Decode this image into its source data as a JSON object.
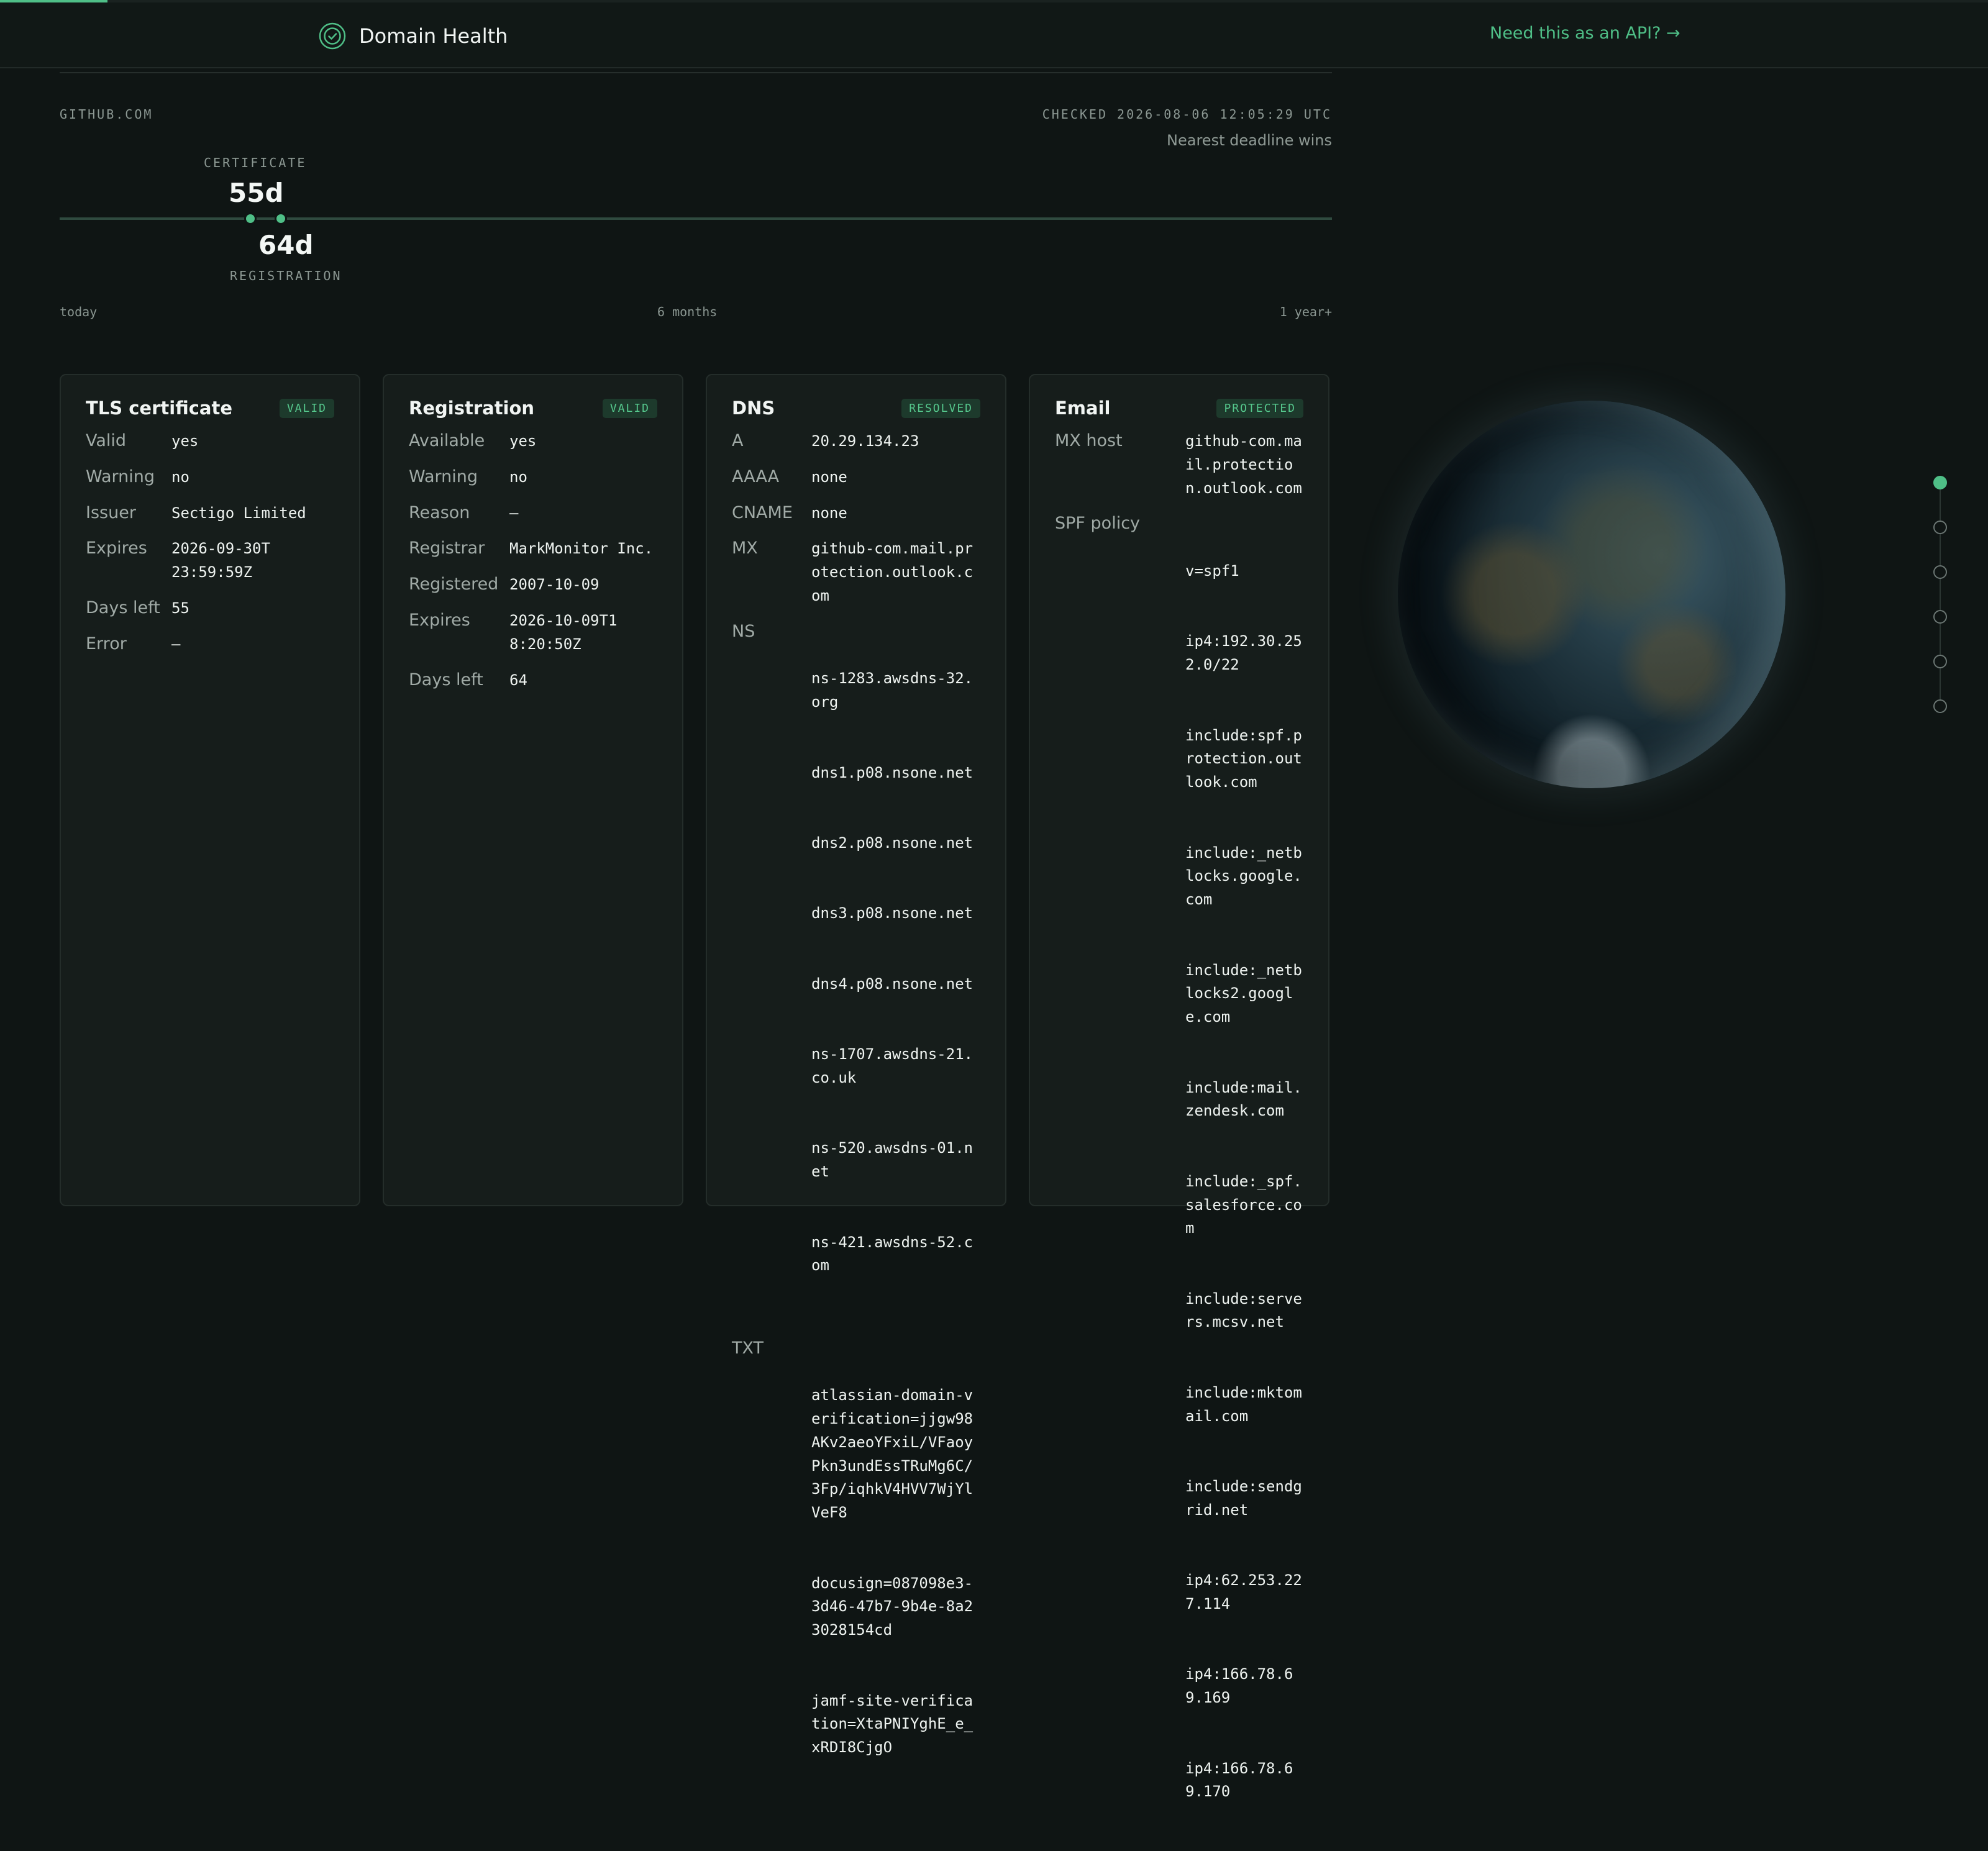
{
  "header": {
    "brand_name": "Domain Health",
    "api_link": "Need this as an API? →",
    "progress": 0.054
  },
  "summary": {
    "domain": "GITHUB.COM",
    "checked": "CHECKED 2026-08-06 12:05:29 UTC",
    "deadline_note": "Nearest deadline wins",
    "certificate_label": "CERTIFICATE",
    "certificate_days": "55d",
    "registration_label": "REGISTRATION",
    "registration_days": "64d",
    "axis": {
      "start": "today",
      "mid": "6 months",
      "end": "1 year+"
    }
  },
  "cards": {
    "tls": {
      "title": "TLS certificate",
      "badge": "VALID",
      "rows": [
        {
          "key": "Valid",
          "value": "yes"
        },
        {
          "key": "Warning",
          "value": "no"
        },
        {
          "key": "Issuer",
          "value": "Sectigo Limited"
        },
        {
          "key": "Expires",
          "value": "2026-09-30T23:59:59Z"
        },
        {
          "key": "Days left",
          "value": "55"
        },
        {
          "key": "Error",
          "value": "—"
        }
      ]
    },
    "registration": {
      "title": "Registration",
      "badge": "VALID",
      "rows": [
        {
          "key": "Available",
          "value": "yes"
        },
        {
          "key": "Warning",
          "value": "no"
        },
        {
          "key": "Reason",
          "value": "—"
        },
        {
          "key": "Registrar",
          "value": "MarkMonitor Inc."
        },
        {
          "key": "Registered",
          "value": "2007-10-09"
        },
        {
          "key": "Expires",
          "value": "2026-10-09T18:20:50Z"
        },
        {
          "key": "Days left",
          "value": "64"
        }
      ]
    },
    "dns": {
      "title": "DNS",
      "badge": "RESOLVED",
      "a_key": "A",
      "a": "20.29.134.23",
      "aaaa_key": "AAAA",
      "aaaa": "none",
      "cname_key": "CNAME",
      "cname": "none",
      "mx_key": "MX",
      "mx": "github-com.mail.protection.outlook.com",
      "ns_key": "NS",
      "ns": [
        "ns-1283.awsdns-32.org",
        "dns1.p08.nsone.net",
        "dns2.p08.nsone.net",
        "dns3.p08.nsone.net",
        "dns4.p08.nsone.net",
        "ns-1707.awsdns-21.co.uk",
        "ns-520.awsdns-01.net",
        "ns-421.awsdns-52.com"
      ],
      "txt_key": "TXT",
      "txt": [
        "atlassian-domain-verification=jjgw98AKv2aeoYFxiL/VFaoyPkn3undEssTRuMg6C/3Fp/iqhkV4HVV7WjYlVeF8",
        "docusign=087098e3-3d46-47b7-9b4e-8a23028154cd",
        "jamf-site-verification=XtaPNIYghE_e_xRDI8CjgO"
      ]
    },
    "email": {
      "title": "Email",
      "badge": "PROTECTED",
      "mx_host_key": "MX host",
      "mx_host": "github-com.mail.protection.outlook.com",
      "spf_key": "SPF policy",
      "spf": [
        "v=spf1",
        "ip4:192.30.252.0/22",
        "include:spf.protection.outlook.com",
        "include:_netblocks.google.com",
        "include:_netblocks2.google.com",
        "include:mail.zendesk.com",
        "include:_spf.salesforce.com",
        "include:servers.mcsv.net",
        "include:mktomail.com",
        "include:sendgrid.net",
        "ip4:62.253.227.114",
        "ip4:166.78.69.169",
        "ip4:166.78.69.170"
      ]
    }
  },
  "side_nav": {
    "count": 6,
    "active_index": 0
  }
}
